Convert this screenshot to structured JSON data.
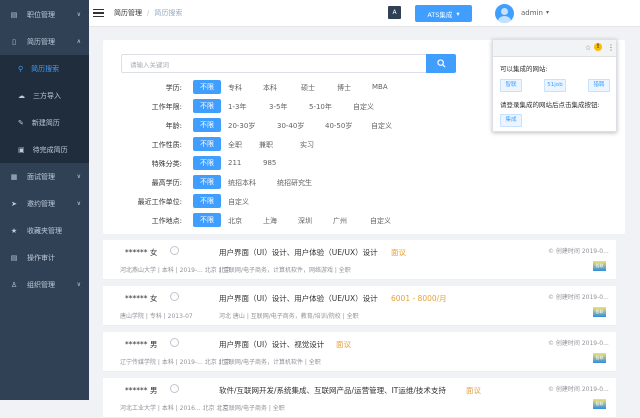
{
  "sidebar": {
    "items": [
      {
        "icon": "list-icon",
        "label": "职位管理",
        "arrow": "∨",
        "open": false
      },
      {
        "icon": "document-icon",
        "label": "简历管理",
        "arrow": "∧",
        "open": true
      },
      {
        "icon": "briefcase-icon",
        "label": "面试管理",
        "arrow": "∨",
        "open": false
      },
      {
        "icon": "paper-plane-icon",
        "label": "邀约管理",
        "arrow": "∨",
        "open": false
      },
      {
        "icon": "star-icon",
        "label": "收藏夹管理",
        "arrow": "",
        "open": false
      },
      {
        "icon": "clipboard-icon",
        "label": "操作审计",
        "arrow": "",
        "open": false
      },
      {
        "icon": "org-icon",
        "label": "组织管理",
        "arrow": "∨",
        "open": false
      }
    ],
    "subitems": [
      {
        "icon": "search-icon",
        "label": "简历搜索",
        "active": true
      },
      {
        "icon": "cloud-upload-icon",
        "label": "三方导入",
        "active": false
      },
      {
        "icon": "edit-icon",
        "label": "新建简历",
        "active": false
      },
      {
        "icon": "pending-icon",
        "label": "待完成简历",
        "active": false
      }
    ]
  },
  "header": {
    "breadcrumb": [
      "简历管理",
      "简历搜索"
    ],
    "separator": "/",
    "a2_label": "A",
    "ats_label": "ATS集成",
    "ats_caret": "▾",
    "username": "admin",
    "user_caret": "▾"
  },
  "search": {
    "placeholder": "请输入关键词"
  },
  "filters": [
    {
      "label": "学历:",
      "options": [
        "不限",
        "专科",
        "本科",
        "硕士",
        "博士",
        "MBA"
      ]
    },
    {
      "label": "工作年限:",
      "options": [
        "不限",
        "1-3年",
        "3-5年",
        "5-10年",
        "自定义"
      ]
    },
    {
      "label": "年龄:",
      "options": [
        "不限",
        "20-30岁",
        "30-40岁",
        "40-50岁",
        "自定义"
      ]
    },
    {
      "label": "工作性质:",
      "options": [
        "不限",
        "全职",
        "兼职",
        "实习"
      ]
    },
    {
      "label": "特殊分类:",
      "options": [
        "不限",
        "211",
        "985"
      ]
    },
    {
      "label": "最高学历:",
      "options": [
        "不限",
        "统招本科",
        "统招研究生"
      ]
    },
    {
      "label": "最近工作单位:",
      "options": [
        "不限",
        "自定义"
      ]
    },
    {
      "label": "工作地点:",
      "options": [
        "不限",
        "北京",
        "上海",
        "深圳",
        "广州",
        "自定义"
      ]
    }
  ],
  "popup": {
    "title1": "可以集成的网站:",
    "sites": [
      "智联",
      "51job",
      "猎聘"
    ],
    "title2": "请登录集成的网站后点击集成按钮:",
    "button": "集成",
    "star": "☆",
    "warn": "!",
    "more": "⋮"
  },
  "results": [
    {
      "name": "****** 女",
      "title": "用户界面（UI）设计、用户体验（UE/UX）设计",
      "salary": "面议",
      "meta": "河北燕山大学 | 本科 | 2019-... 北京 北京",
      "meta2": "| 互联网/电子商务，计算机软件，网络游戏 | 全职",
      "time": "© 创建时间 2019-0...",
      "logo": "智联"
    },
    {
      "name": "****** 女",
      "title": "用户界面（UI）设计、用户体验（UE/UX）设计",
      "salary": "6001 - 8000/月",
      "meta": "唐山学院 | 专科 | 2013-07",
      "meta2": "河北 唐山 | 互联网/电子商务，教育/培训/院校 | 全职",
      "time": "© 创建时间 2019-0...",
      "logo": "智联"
    },
    {
      "name": "****** 男",
      "title": "用户界面（UI）设计、视觉设计",
      "salary": "面议",
      "meta": "辽宁传媒学院 | 本科 | 2019-... 北京 北京",
      "meta2": "| 互联网/电子商务，计算机软件 | 全职",
      "time": "© 创建时间 2019-0...",
      "logo": "智联"
    },
    {
      "name": "****** 男",
      "title": "软件/互联网开发/系统集成、互联网产品/运营管理、IT运维/技术支持",
      "salary": "面议",
      "meta": "河北工业大学 | 本科 | 2016... 北京 北京",
      "meta2": "| 互联网/电子商务 | 全职",
      "time": "© 创建时间 2019-0...",
      "logo": "智联"
    }
  ]
}
